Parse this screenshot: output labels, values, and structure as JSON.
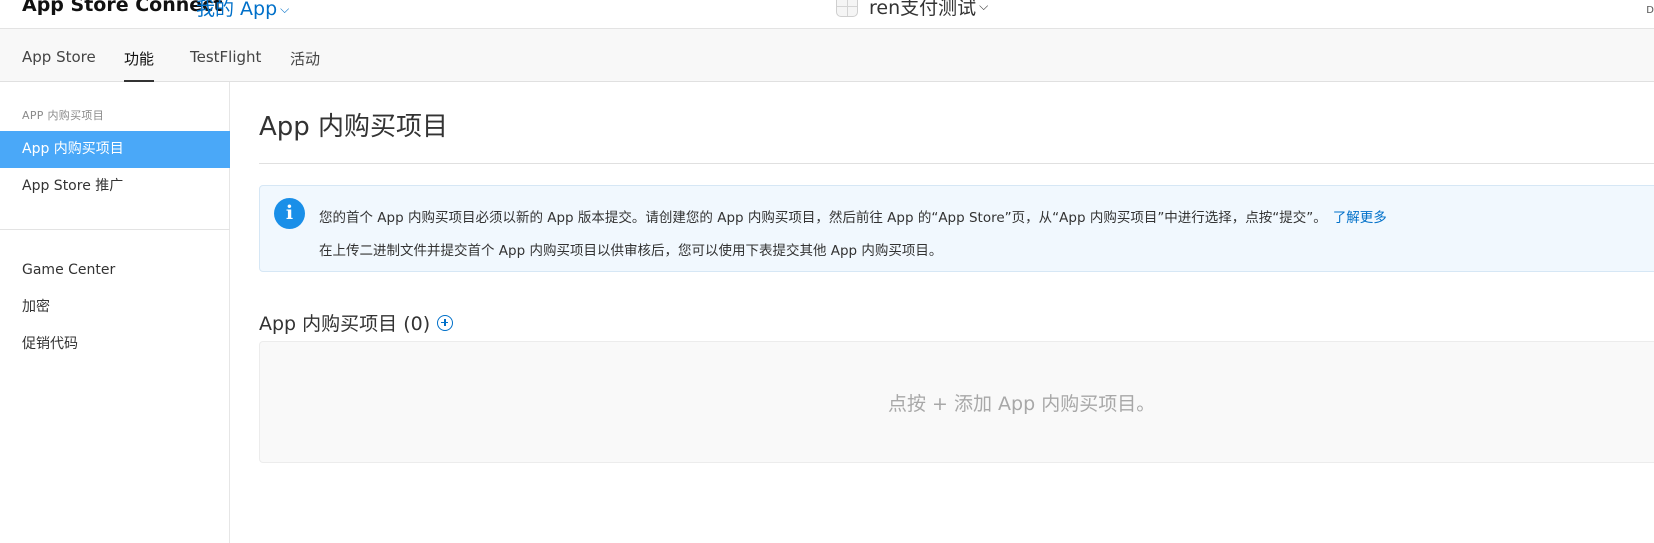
{
  "header": {
    "brand": "App Store Connect",
    "my_apps": "我的 App",
    "app_name": "ren支付测试",
    "user_fragment": "D"
  },
  "tabs": [
    {
      "label": "App Store",
      "active": false
    },
    {
      "label": "功能",
      "active": true
    },
    {
      "label": "TestFlight",
      "active": false
    },
    {
      "label": "活动",
      "active": false
    }
  ],
  "sidebar": {
    "section_header": "APP 内购买项目",
    "items": [
      {
        "label": "App 内购买项目",
        "active": true
      },
      {
        "label": "App Store 推广",
        "active": false
      },
      {
        "label": "Game Center",
        "active": false
      },
      {
        "label": "加密",
        "active": false
      },
      {
        "label": "促销代码",
        "active": false
      }
    ]
  },
  "main": {
    "title": "App 内购买项目",
    "info": {
      "line1": "您的首个 App 内购买项目必须以新的 App 版本提交。请创建您的 App 内购买项目，然后前往 App 的“App Store”页，从“App 内购买项目”中进行选择，点按“提交”。",
      "learn_more": "了解更多",
      "line2": "在上传二进制文件并提交首个 App 内购买项目以供审核后，您可以使用下表提交其他 App 内购买项目。"
    },
    "list_title": "App 内购买项目 (0)",
    "empty_message": "点按 + 添加 App 内购买项目。"
  },
  "colors": {
    "accent": "#0070c9",
    "sidebar_active": "#4aa8f8",
    "info_bg": "#f1f8fe",
    "info_icon": "#1a8fe8"
  },
  "icons": {
    "my_apps_dropdown": "chevron-down-icon",
    "app_dropdown": "chevron-down-icon",
    "info": "info-icon",
    "add": "add-circle-icon"
  }
}
